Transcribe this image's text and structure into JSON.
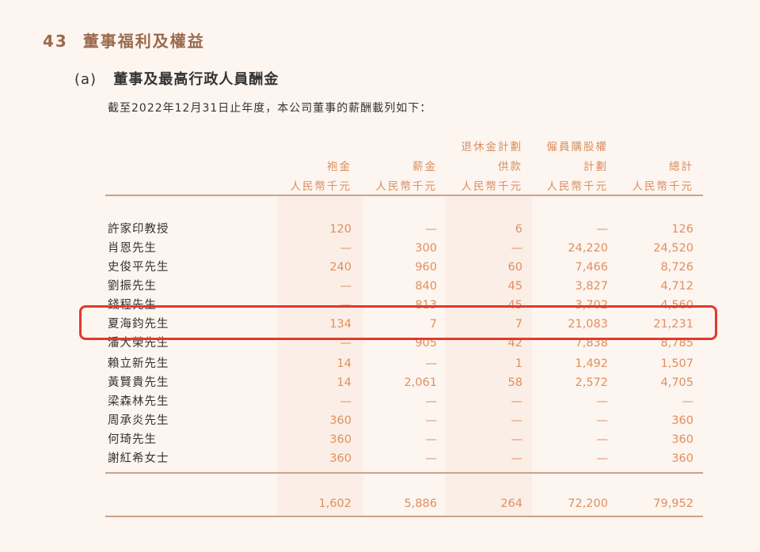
{
  "section": {
    "number": "43",
    "title": "董事福利及權益"
  },
  "subsection": {
    "mark": "(a)",
    "title": "董事及最高行政人員酬金"
  },
  "intro": "截至2022年12月31日止年度，本公司董事的薪酬載列如下：",
  "columns": [
    {
      "line1": "",
      "line2": "袍金",
      "unit": "人民幣千元"
    },
    {
      "line1": "",
      "line2": "薪金",
      "unit": "人民幣千元"
    },
    {
      "line1": "退休金計劃",
      "line2": "供款",
      "unit": "人民幣千元"
    },
    {
      "line1": "僱員購股權",
      "line2": "計劃",
      "unit": "人民幣千元"
    },
    {
      "line1": "",
      "line2": "總計",
      "unit": "人民幣千元"
    }
  ],
  "rows": [
    {
      "name": "許家印教授",
      "values": [
        "120",
        "—",
        "6",
        "—",
        "126"
      ]
    },
    {
      "name": "肖恩先生",
      "values": [
        "—",
        "300",
        "—",
        "24,220",
        "24,520"
      ]
    },
    {
      "name": "史俊平先生",
      "values": [
        "240",
        "960",
        "60",
        "7,466",
        "8,726"
      ]
    },
    {
      "name": "劉振先生",
      "values": [
        "—",
        "840",
        "45",
        "3,827",
        "4,712"
      ]
    },
    {
      "name": "錢程先生",
      "values": [
        "—",
        "813",
        "45",
        "3,702",
        "4,560"
      ]
    },
    {
      "name": "夏海鈞先生",
      "values": [
        "134",
        "7",
        "7",
        "21,083",
        "21,231"
      ]
    },
    {
      "name": "潘大榮先生",
      "values": [
        "—",
        "905",
        "42",
        "7,838",
        "8,785"
      ]
    },
    {
      "name": "賴立新先生",
      "values": [
        "14",
        "—",
        "1",
        "1,492",
        "1,507"
      ]
    },
    {
      "name": "黃賢貴先生",
      "values": [
        "14",
        "2,061",
        "58",
        "2,572",
        "4,705"
      ]
    },
    {
      "name": "梁森林先生",
      "values": [
        "—",
        "—",
        "—",
        "—",
        "—"
      ]
    },
    {
      "name": "周承炎先生",
      "values": [
        "360",
        "—",
        "—",
        "—",
        "360"
      ]
    },
    {
      "name": "何琦先生",
      "values": [
        "360",
        "—",
        "—",
        "—",
        "360"
      ]
    },
    {
      "name": "謝紅希女士",
      "values": [
        "360",
        "—",
        "—",
        "—",
        "360"
      ]
    }
  ],
  "totals": [
    "1,602",
    "5,886",
    "264",
    "72,200",
    "79,952"
  ],
  "colors": {
    "heading": "#9a6a4c",
    "accent": "#e08f5f",
    "highlight": "#e0392b",
    "rule": "#c9a389"
  }
}
